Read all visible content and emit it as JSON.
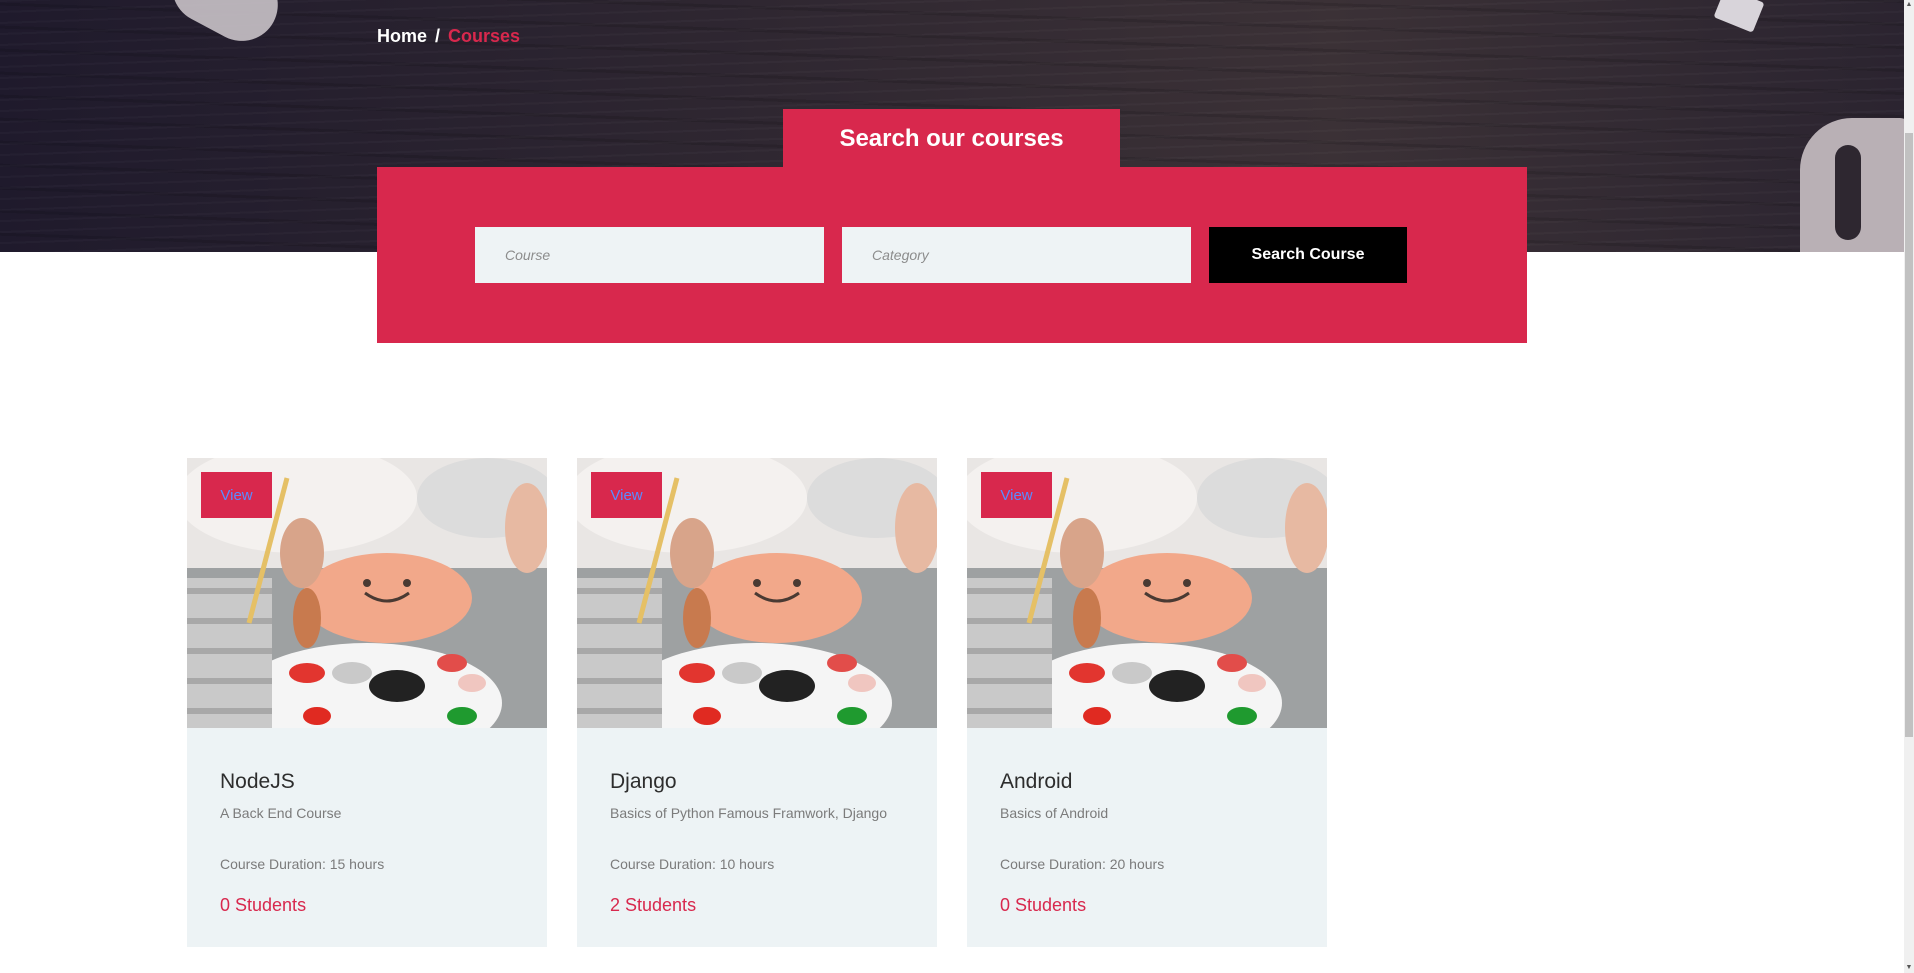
{
  "breadcrumb": {
    "home": "Home",
    "separator": "/",
    "current": "Courses"
  },
  "search": {
    "heading": "Search our courses",
    "course_placeholder": "Course",
    "category_placeholder": "Category",
    "button_label": "Search Course"
  },
  "courses": [
    {
      "view_label": "View",
      "title": "NodeJS",
      "description": "A Back End Course",
      "duration": "Course Duration: 15 hours",
      "students": "0 Students"
    },
    {
      "view_label": "View",
      "title": "Django",
      "description": "Basics of Python Famous Framwork, Django",
      "duration": "Course Duration: 10 hours",
      "students": "2 Students"
    },
    {
      "view_label": "View",
      "title": "Android",
      "description": "Basics of Android",
      "duration": "Course Duration: 20 hours",
      "students": "0 Students"
    }
  ],
  "colors": {
    "accent": "#d8284d",
    "card_bg": "#edf3f5",
    "button_dark": "#000000"
  },
  "icons": {
    "course_image": "painting-palette-image"
  }
}
